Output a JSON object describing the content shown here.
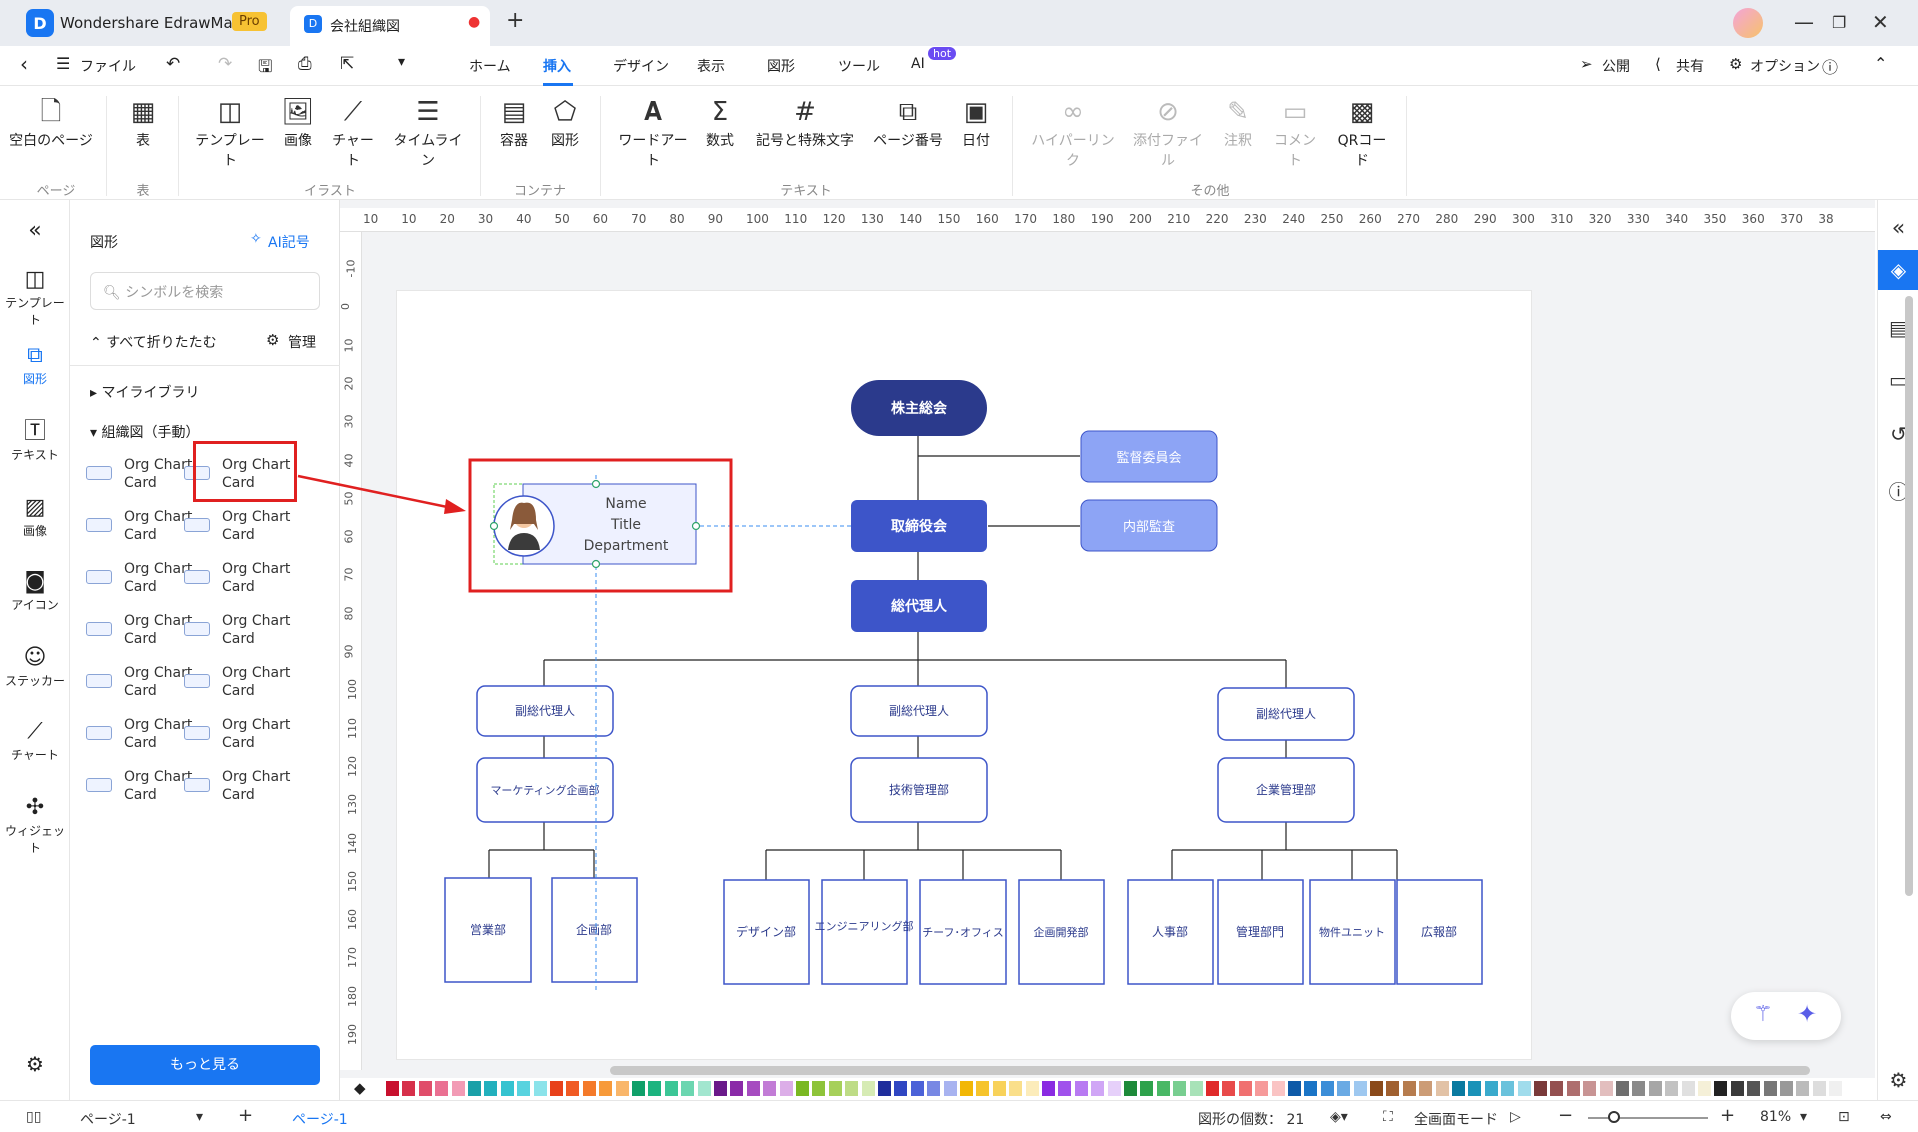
{
  "titlebar": {
    "app_name": "Wondershare EdrawMax",
    "pro_label": "Pro",
    "doc_tab": "会社組織図",
    "new_tab": "+"
  },
  "menubar": {
    "file_label": "ファイル",
    "tabs": [
      "ホーム",
      "挿入",
      "デザイン",
      "表示",
      "図形",
      "ツール",
      "AI"
    ],
    "active_tab": "挿入",
    "ai_badge": "hot",
    "publish": "公開",
    "share": "共有",
    "options": "オプション"
  },
  "ribbon": {
    "blank_page": "空白のページ",
    "table": "表",
    "template": "テンプレート",
    "image": "画像",
    "chart": "チャート",
    "timeline": "タイムライン",
    "container": "容器",
    "shape": "図形",
    "wordart": "ワードアート",
    "formula": "数式",
    "symbols": "記号と特殊文字",
    "page_number": "ページ番号",
    "date": "日付",
    "hyperlink": "ハイパーリンク",
    "attachment": "添付ファイル",
    "note": "注釈",
    "comment": "コメント",
    "qrcode": "QRコード",
    "groups": {
      "page": "ページ",
      "table": "表",
      "illustration": "イラスト",
      "container": "コンテナ",
      "text": "テキスト",
      "other": "その他"
    }
  },
  "leftbar": {
    "collapse": "«",
    "items": [
      "テンプレート",
      "図形",
      "テキスト",
      "画像",
      "アイコン",
      "ステッカー",
      "チャート",
      "ウィジェット"
    ],
    "active": "図形"
  },
  "panel": {
    "title": "図形",
    "ai_symbol": "AI記号",
    "search_placeholder": "シンボルを検索",
    "collapse_all": "すべて折りたたむ",
    "manage": "管理",
    "my_library": "マイライブラリ",
    "org_manual": "組織図（手動）",
    "card_line1": "Org Chart",
    "card_line2": "Card",
    "more": "もっと見る"
  },
  "rulers": {
    "h_ticks": [
      "10",
      "10",
      "20",
      "30",
      "40",
      "50",
      "60",
      "70",
      "80",
      "90",
      "100",
      "110",
      "120",
      "130",
      "140",
      "150",
      "160",
      "170",
      "180",
      "190",
      "200",
      "210",
      "220",
      "230",
      "240",
      "250",
      "260",
      "270",
      "280",
      "290",
      "300",
      "310",
      "320",
      "330",
      "340",
      "350",
      "360",
      "370",
      "38"
    ],
    "v_ticks": [
      "-10",
      "0",
      "10",
      "20",
      "30",
      "40",
      "50",
      "60",
      "70",
      "80",
      "90",
      "100",
      "110",
      "120",
      "130",
      "140",
      "150",
      "160",
      "170",
      "180",
      "190"
    ]
  },
  "diagram": {
    "shareholders": "株主総会",
    "supervisory": "監督委員会",
    "internal_audit": "内部監査",
    "board": "取締役会",
    "general_agent": "総代理人",
    "deputy": "副総代理人",
    "marketing": "マーケティング企画部",
    "tech": "技術管理部",
    "corp": "企業管理部",
    "sales": "営業部",
    "planning": "企画部",
    "design": "デザイン部",
    "engineering": "エンジニアリング部",
    "chief_office": "チーフ･オフィス",
    "product_dev": "企画開発部",
    "hr": "人事部",
    "admin": "管理部門",
    "property": "物件ユニット",
    "pr": "広報部",
    "card_name": "Name",
    "card_title": "Title",
    "card_dept": "Department"
  },
  "statusbar": {
    "page_select": "ページ-1",
    "page_tab": "ページ-1",
    "shape_count": "図形の個数：  21",
    "fullscreen": "全画面モード",
    "zoom": "81%"
  },
  "colors": {
    "dark_navy": "#2b3a8c",
    "royal_blue": "#3d55c9",
    "light_blue": "#8da4f5",
    "outline_blue": "#3d55c9",
    "accent": "#1976f2",
    "highlight_red": "#e02020"
  }
}
